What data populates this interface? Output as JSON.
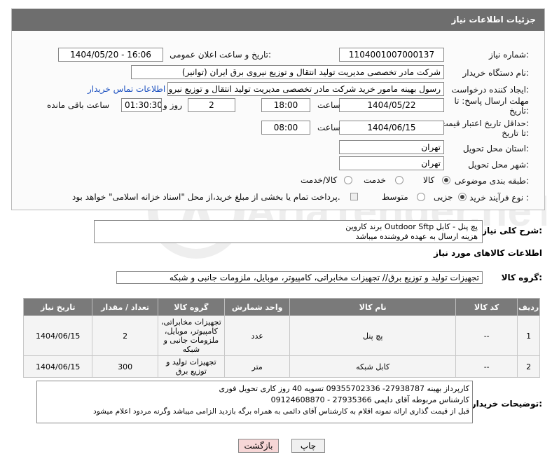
{
  "header": {
    "title": "جزئیات اطلاعات نیاز"
  },
  "form": {
    "need_number_label": "شماره نیاز:",
    "need_number": "1104001007000137",
    "announce_label": "تاریخ و ساعت اعلان عمومی:",
    "announce_value": "1404/05/20 - 16:06",
    "buyer_label": "نام دستگاه خریدار:",
    "buyer_value": "شرکت مادر تخصصی مدیریت تولید  انتقال و توزیع نیروی برق ایران (توانیر)",
    "creator_label": "ایجاد کننده درخواست:",
    "creator_value": "رسول بهینه مامور خرید شرکت مادر تخصصی مدیریت تولید  انتقال و توزیع نیروی",
    "contact_link": "اطلاعات تماس خریدار",
    "deadline_label_1": "مهلت ارسال پاسخ: تا",
    "deadline_label_2": "تاریخ:",
    "deadline_date": "1404/05/22",
    "time_label": "ساعت",
    "deadline_time": "18:00",
    "days_value": "2",
    "days_label": "روز و",
    "remaining_value": "01:30:30",
    "remaining_label": "ساعت باقی مانده",
    "validity_label_1": "حداقل تاریخ اعتبار قیمت:",
    "validity_label_2": "تا تاریخ:",
    "validity_date": "1404/06/15",
    "validity_time": "08:00",
    "province_label": "استان محل تحویل:",
    "province_value": "تهران",
    "city_label": "شهر محل تحویل:",
    "city_value": "تهران",
    "category_label": "طبقه بندی موضوعی:",
    "category_options": [
      "کالا",
      "خدمت",
      "کالا/خدمت"
    ],
    "process_label": "نوع فرآیند خرید :",
    "process_options": [
      "جزیی",
      "متوسط"
    ],
    "payment_note": "پرداخت تمام یا بخشی از مبلغ خرید،از محل \"اسناد خزانه اسلامی\" خواهد بود."
  },
  "description": {
    "label": "شرح کلی نیاز:",
    "line1": "پچ پنل - کابل  Outdoor Sftp  برند کاروین",
    "line2": "هزینه ارسال به عهده فروشنده میباشد"
  },
  "goods_info_title": "اطلاعات کالاهای مورد نیاز",
  "goods_group": {
    "label": "گروه کالا:",
    "value": "تجهیزات تولید و توزیع برق// تجهیزات مخابراتی، کامپیوتر، موبایل، ملزومات جانبی و شبکه"
  },
  "table": {
    "headers": [
      "ردیف",
      "کد کالا",
      "نام کالا",
      "واحد شمارش",
      "گروه کالا",
      "تعداد / مقدار",
      "تاریخ نیاز"
    ],
    "rows": [
      [
        "1",
        "--",
        "پچ پنل",
        "عدد",
        "تجهیزات مخابراتی، کامپیوتر، موبایل، ملزومات جانبی و شبکه",
        "2",
        "1404/06/15"
      ],
      [
        "2",
        "--",
        "کابل شبکه",
        "متر",
        "تجهیزات تولید و توزیع برق",
        "300",
        "1404/06/15"
      ]
    ]
  },
  "buyer_notes": {
    "label": "توضیحات خریدار:",
    "line1": "کارپرداز بهینه 27938787- 09355702336  تسویه 40 روز کاری  تحویل فوری",
    "line2": "کارشناس مربوطه آقای دایمی 27935366 - 09124608870",
    "line3": "قبل از قیمت گذاری ارائه نمونه اقلام به کارشناس آقای دائمی به همراه برگه بازدید الزامی میباشد وگرنه مردود اعلام میشود"
  },
  "buttons": {
    "print": "چاپ",
    "back": "بازگشت"
  },
  "watermark": {
    "text": "AriaTender.neT"
  },
  "colors": {
    "header_bg": "#6e6e6e",
    "link": "#1a4fbf",
    "back_button_bg": "#f6d6d6"
  }
}
